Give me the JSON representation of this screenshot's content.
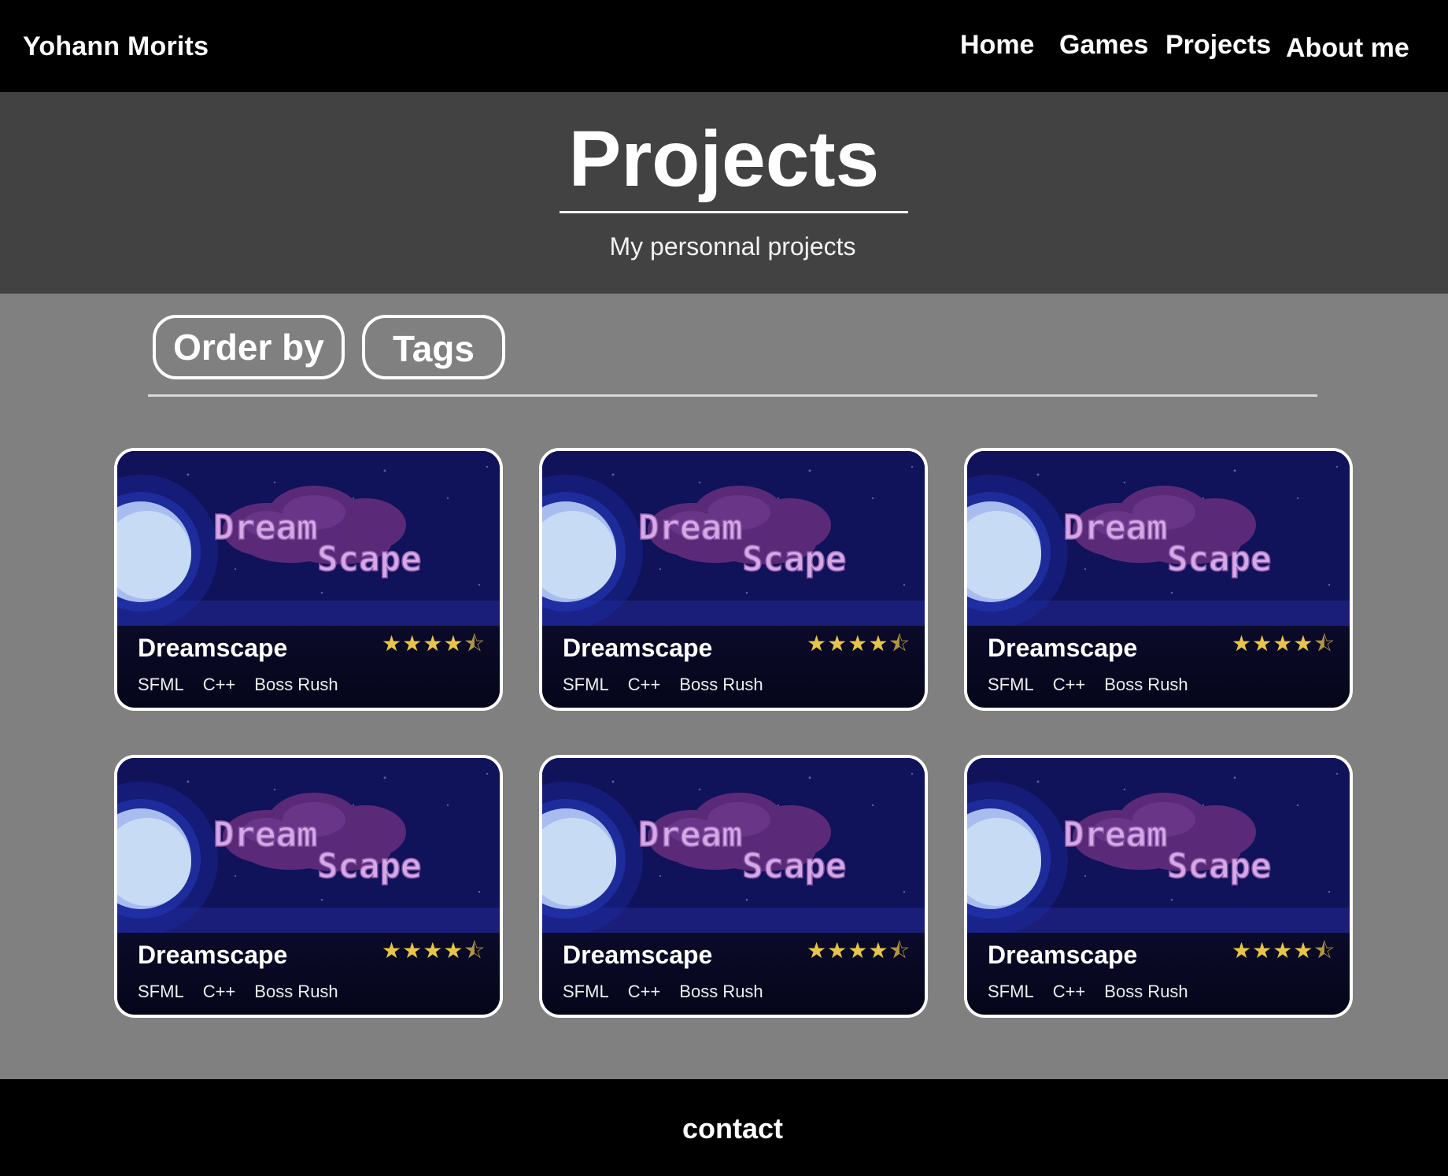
{
  "header": {
    "brand": "Yohann Morits",
    "nav": [
      {
        "label": "Home"
      },
      {
        "label": "Games"
      },
      {
        "label": "Projects"
      },
      {
        "label": "About me"
      }
    ]
  },
  "hero": {
    "title": "Projects",
    "subtitle": "My personnal projects"
  },
  "filters": {
    "order_by": "Order by",
    "tags": "Tags"
  },
  "cards": [
    {
      "title": "Dreamscape",
      "rating": 4.5,
      "tags": [
        "SFML",
        "C++",
        "Boss Rush"
      ],
      "banner_text_1": "Dream",
      "banner_text_2": "Scape"
    },
    {
      "title": "Dreamscape",
      "rating": 4.5,
      "tags": [
        "SFML",
        "C++",
        "Boss Rush"
      ],
      "banner_text_1": "Dream",
      "banner_text_2": "Scape"
    },
    {
      "title": "Dreamscape",
      "rating": 4.5,
      "tags": [
        "SFML",
        "C++",
        "Boss Rush"
      ],
      "banner_text_1": "Dream",
      "banner_text_2": "Scape"
    },
    {
      "title": "Dreamscape",
      "rating": 4.5,
      "tags": [
        "SFML",
        "C++",
        "Boss Rush"
      ],
      "banner_text_1": "Dream",
      "banner_text_2": "Scape"
    },
    {
      "title": "Dreamscape",
      "rating": 4.5,
      "tags": [
        "SFML",
        "C++",
        "Boss Rush"
      ],
      "banner_text_1": "Dream",
      "banner_text_2": "Scape"
    },
    {
      "title": "Dreamscape",
      "rating": 4.5,
      "tags": [
        "SFML",
        "C++",
        "Boss Rush"
      ],
      "banner_text_1": "Dream",
      "banner_text_2": "Scape"
    }
  ],
  "footer": {
    "contact": "contact"
  },
  "colors": {
    "topbar": "#000000",
    "hero": "#424242",
    "content": "#808080",
    "star": "#e8c547",
    "banner": "#121463"
  },
  "icons": {
    "star": "star-icon",
    "half_star": "half-star-icon",
    "moon": "moon-icon"
  }
}
